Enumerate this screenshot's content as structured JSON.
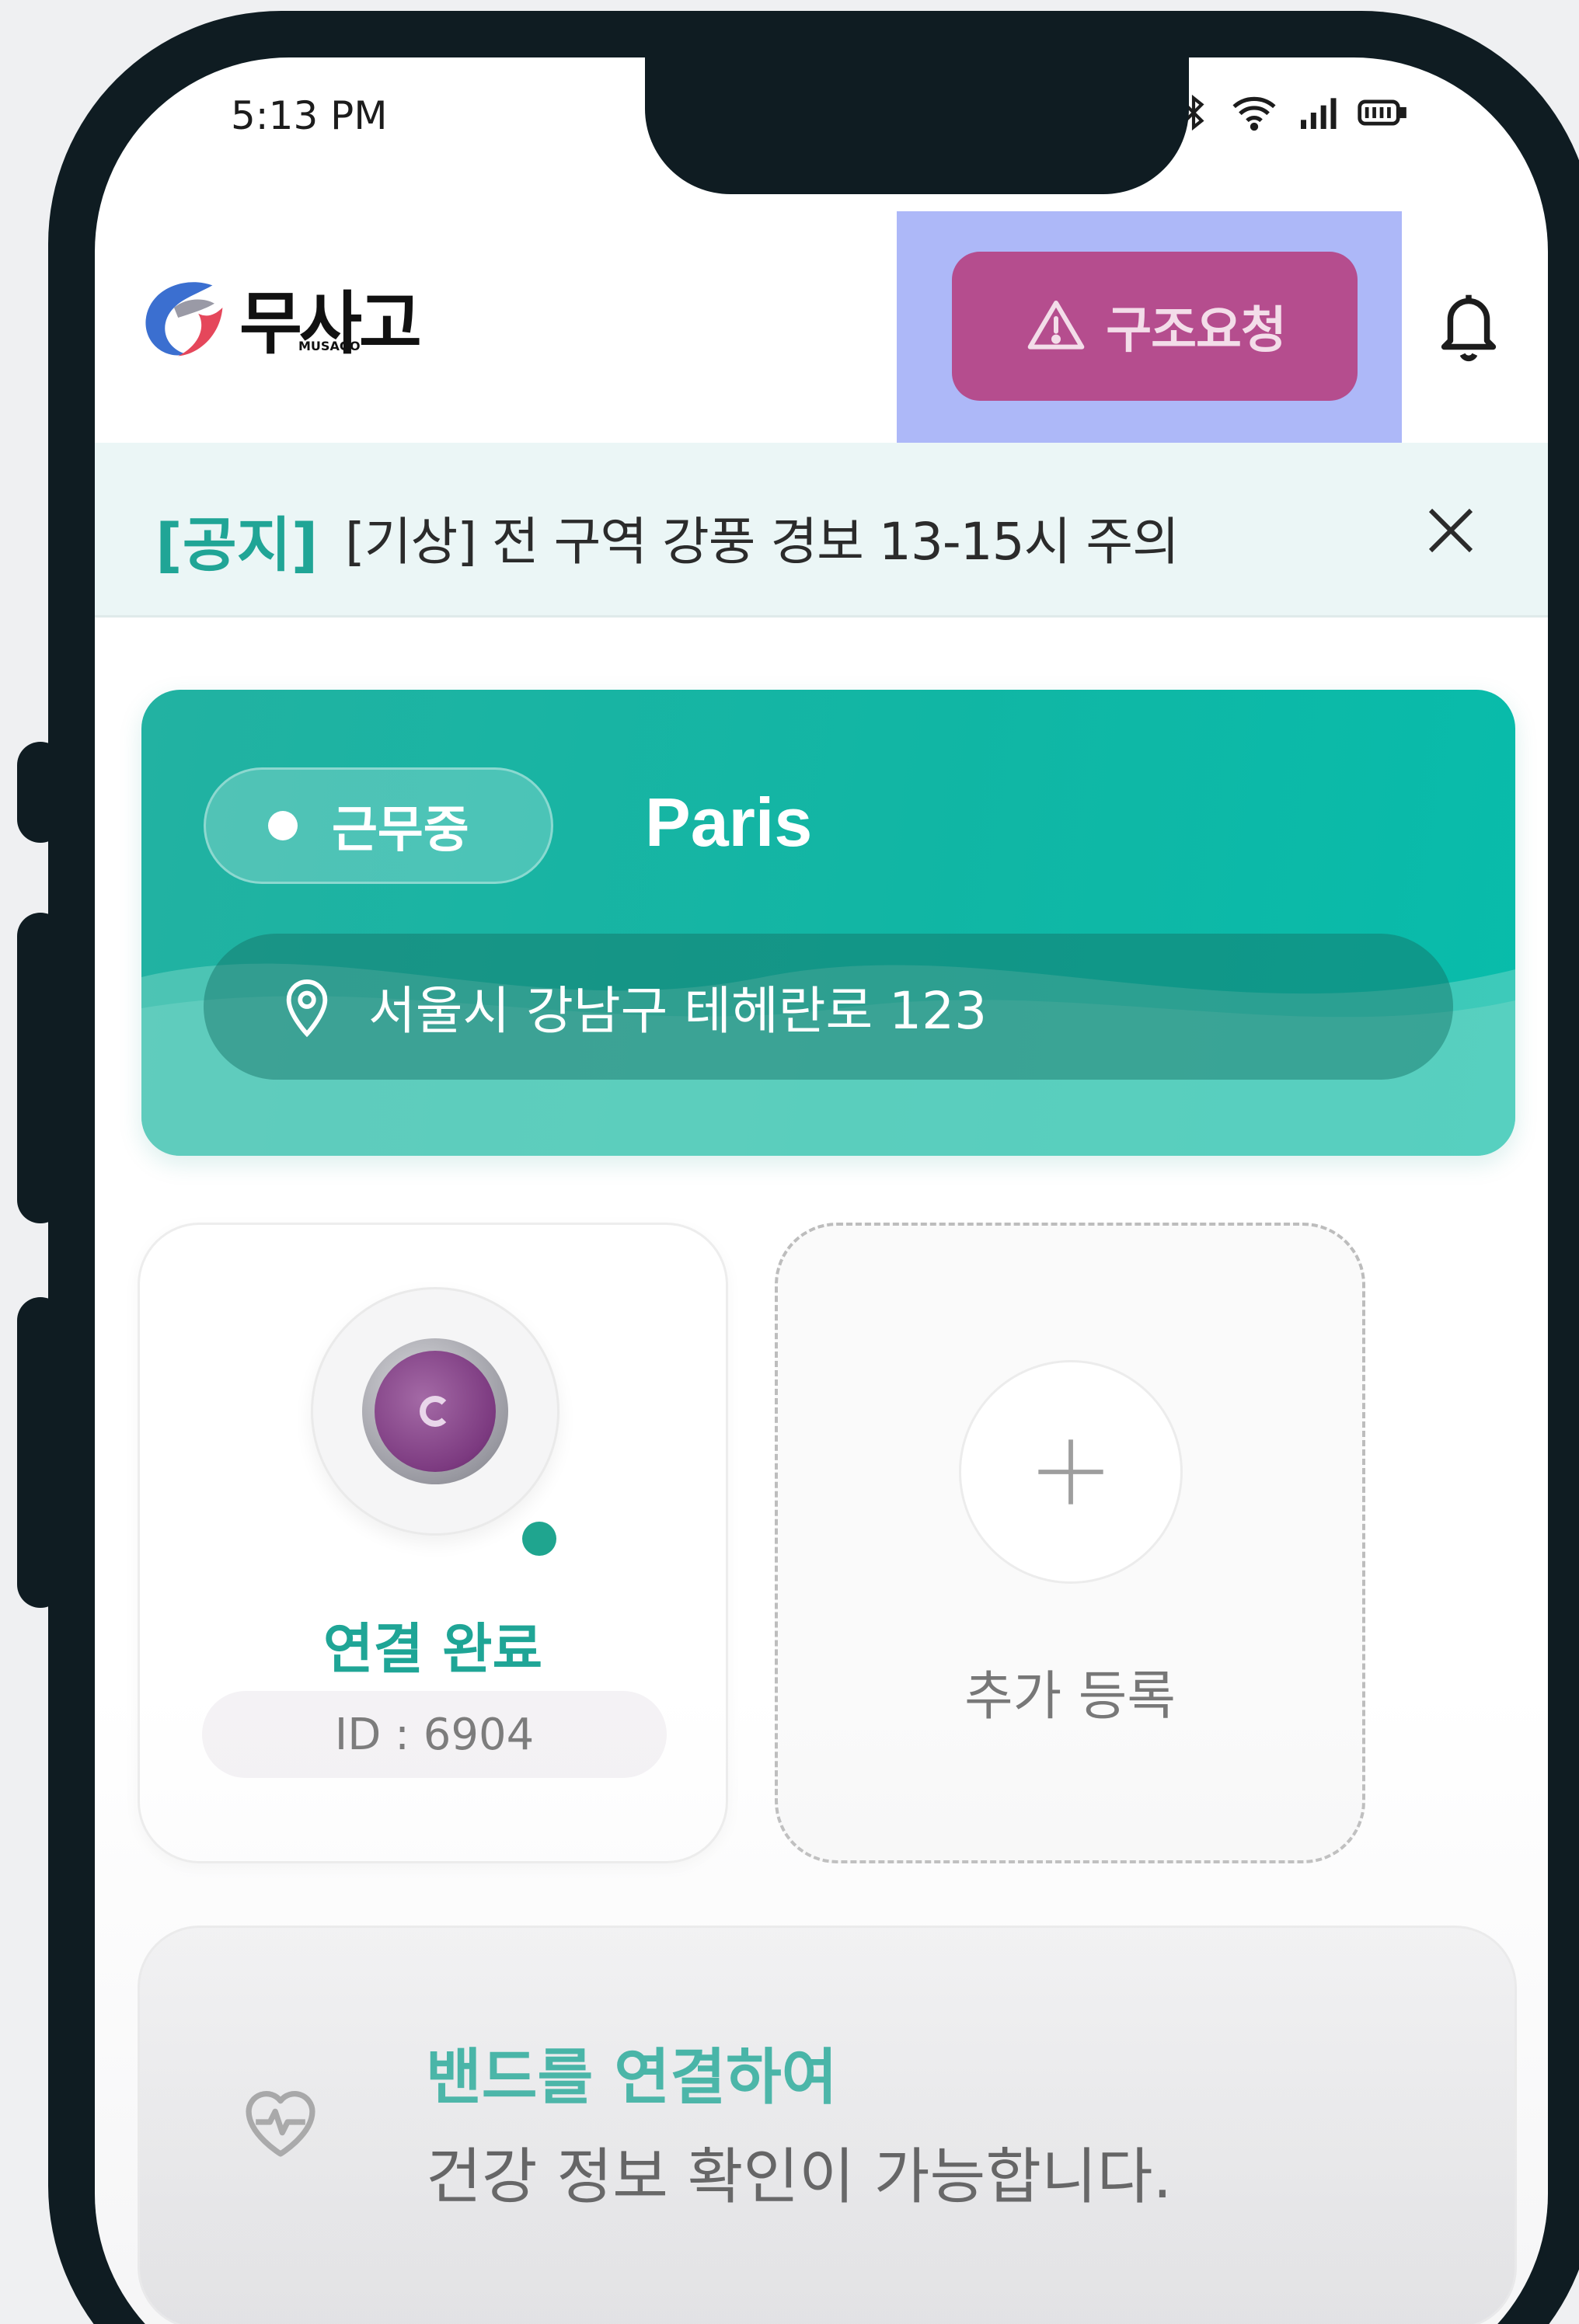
{
  "status_bar": {
    "time": "5:13 PM",
    "icons": [
      "alarm-icon",
      "bluetooth-icon",
      "wifi-icon",
      "signal-icon",
      "battery-icon"
    ]
  },
  "header": {
    "logo_text": "무사고",
    "logo_subtext": "MUSAGO",
    "sos_label": "구조요청",
    "notification_icon": "bell-icon"
  },
  "notice": {
    "tag": "[공지]",
    "text": "[기상] 전 구역 강풍 경보 13-15시 주의",
    "close_icon": "close-icon"
  },
  "work_card": {
    "status": "근무중",
    "name": "Paris",
    "address": "서울시 강남구 테헤란로 123"
  },
  "devices": {
    "connected": {
      "status": "연결 완료",
      "id": "ID : 6904"
    },
    "add": {
      "label": "추가 등록"
    }
  },
  "hint": {
    "title": "밴드를 연결하여",
    "body": "건강 정보 확인이 가능합니다."
  },
  "colors": {
    "accent_teal": "#1fa596",
    "sos": "#b54d8e",
    "frame": "#0f1c22"
  }
}
